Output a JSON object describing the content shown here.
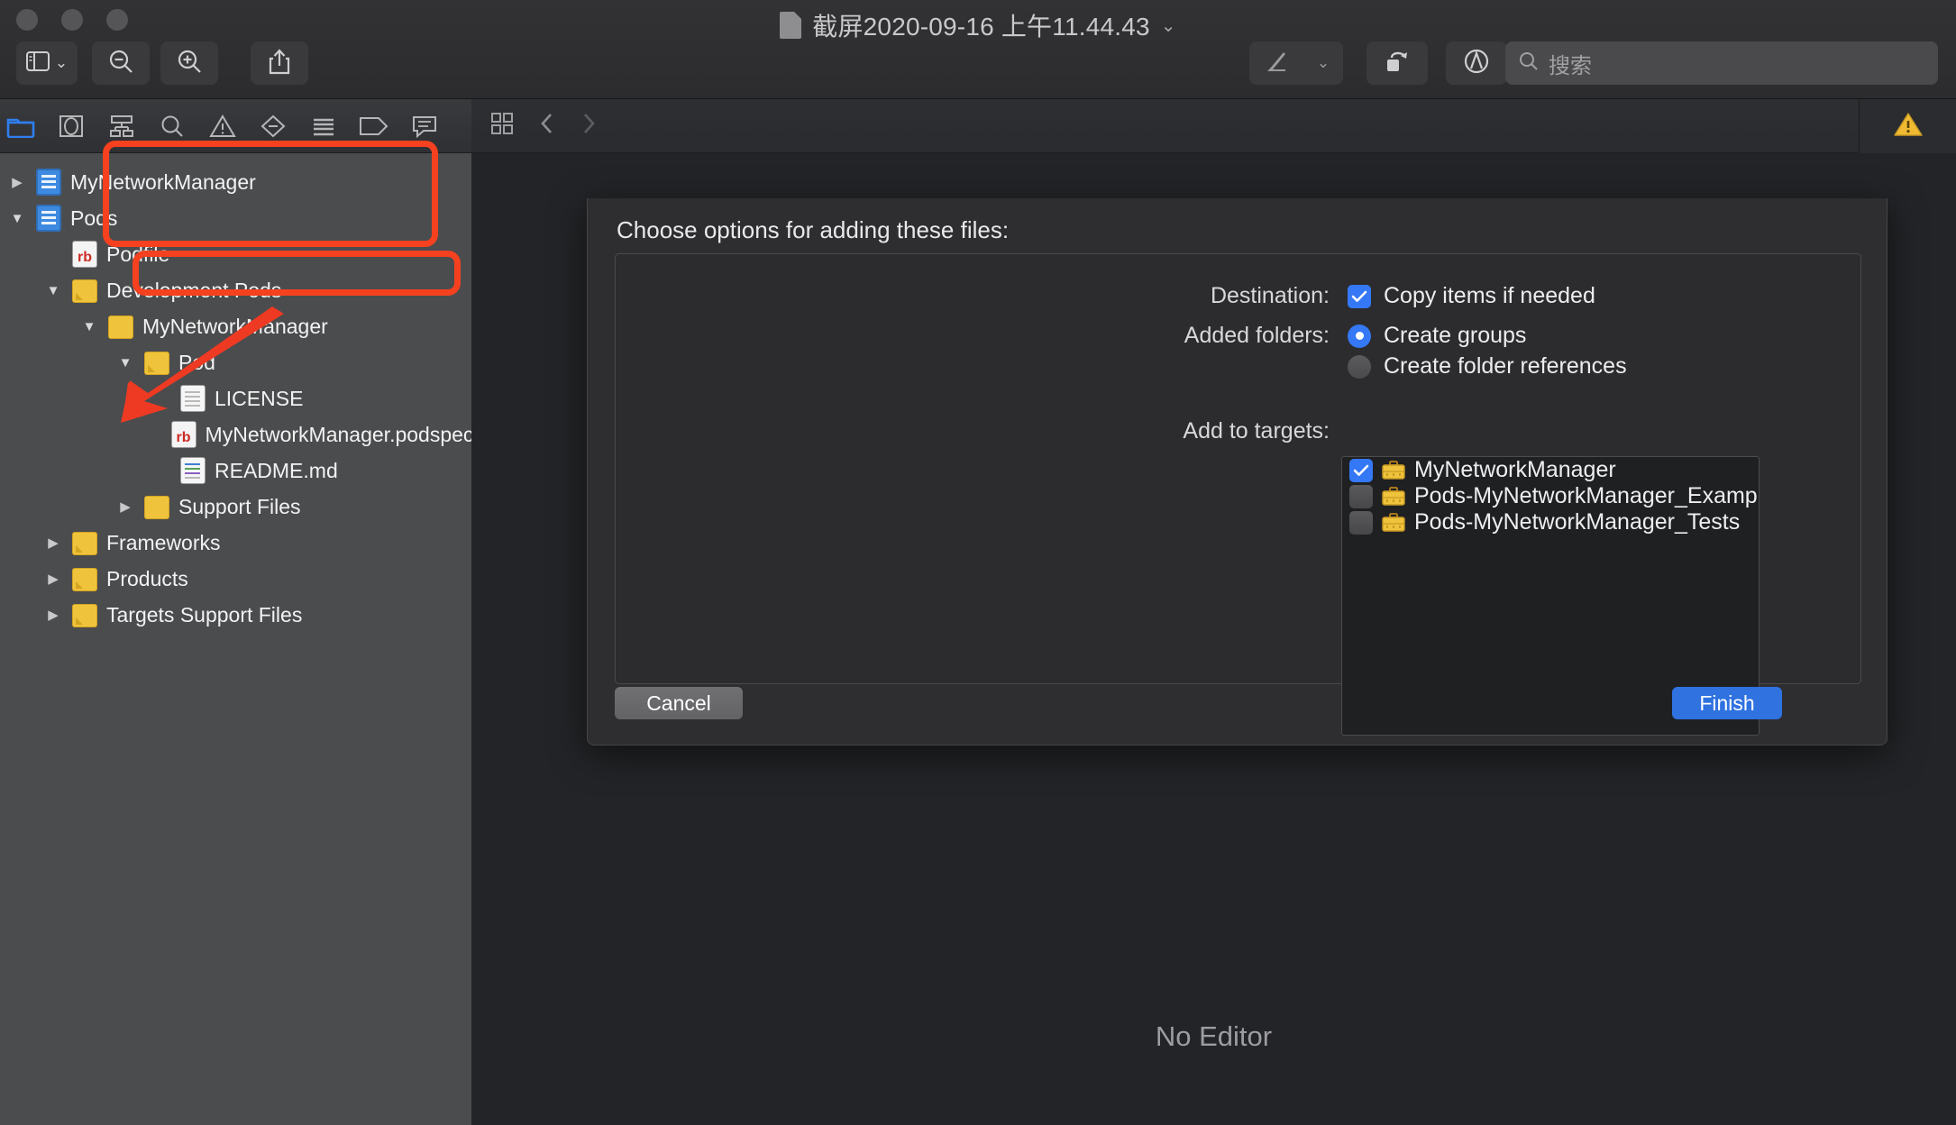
{
  "window": {
    "title": "截屏2020-09-16 上午11.44.43",
    "title_chevron": "⌄",
    "traffic_lights": [
      "close",
      "minimize",
      "zoom"
    ],
    "toolbar_left": [
      {
        "name": "sidebar-toggle",
        "icon": "sidebar-icon"
      },
      {
        "name": "zoom-out",
        "icon": "magnifier-minus-icon"
      },
      {
        "name": "zoom-in",
        "icon": "magnifier-plus-icon"
      },
      {
        "name": "share",
        "icon": "share-icon"
      }
    ],
    "toolbar_right": [
      {
        "name": "markup-tool",
        "icon": "pen-icon"
      },
      {
        "name": "rotate-tool",
        "icon": "rotate-icon"
      },
      {
        "name": "annotate-tool",
        "icon": "circle-a-icon"
      }
    ],
    "search": {
      "placeholder": "搜索",
      "value": "",
      "icon": "search-icon"
    }
  },
  "navigator": {
    "tabs": [
      {
        "name": "project-navigator",
        "icon": "folder-icon",
        "selected": true
      },
      {
        "name": "source-control-navigator",
        "icon": "version-icon",
        "selected": false
      },
      {
        "name": "symbol-navigator",
        "icon": "hierarchy-icon",
        "selected": false
      },
      {
        "name": "find-navigator",
        "icon": "search-icon",
        "selected": false
      },
      {
        "name": "issue-navigator",
        "icon": "warning-triangle-icon",
        "selected": false
      },
      {
        "name": "test-navigator",
        "icon": "diamond-minus-icon",
        "selected": false
      },
      {
        "name": "debug-navigator",
        "icon": "list-icon",
        "selected": false
      },
      {
        "name": "breakpoint-navigator",
        "icon": "tag-icon",
        "selected": false
      },
      {
        "name": "report-navigator",
        "icon": "comment-icon",
        "selected": false
      }
    ],
    "tree": [
      {
        "label": "MyNetworkManager",
        "indent": 0,
        "twisty": "collapsed",
        "icon": "project"
      },
      {
        "label": "Pods",
        "indent": 0,
        "twisty": "expanded",
        "icon": "project"
      },
      {
        "label": "Podfile",
        "indent": 1,
        "twisty": "none",
        "icon": "rb"
      },
      {
        "label": "Development Pods",
        "indent": 1,
        "twisty": "expanded",
        "icon": "folder-dogear"
      },
      {
        "label": "MyNetworkManager",
        "indent": 2,
        "twisty": "expanded",
        "icon": "folder"
      },
      {
        "label": "Pod",
        "indent": 3,
        "twisty": "expanded",
        "icon": "folder-dogear"
      },
      {
        "label": "LICENSE",
        "indent": 4,
        "twisty": "none",
        "icon": "file"
      },
      {
        "label": "MyNetworkManager.podspec",
        "indent": 4,
        "twisty": "none",
        "icon": "rb"
      },
      {
        "label": "README.md",
        "indent": 4,
        "twisty": "none",
        "icon": "md"
      },
      {
        "label": "Support Files",
        "indent": 3,
        "twisty": "collapsed",
        "icon": "folder"
      },
      {
        "label": "Frameworks",
        "indent": 1,
        "twisty": "collapsed",
        "icon": "folder-dogear"
      },
      {
        "label": "Products",
        "indent": 1,
        "twisty": "collapsed",
        "icon": "folder-dogear"
      },
      {
        "label": "Targets Support Files",
        "indent": 1,
        "twisty": "collapsed",
        "icon": "folder-dogear"
      }
    ]
  },
  "editor": {
    "jumpbar": [
      {
        "name": "related-items",
        "icon": "grid-icon"
      },
      {
        "name": "go-back",
        "icon": "chevron-left-icon"
      },
      {
        "name": "go-forward",
        "icon": "chevron-right-icon"
      }
    ],
    "placeholder": "No Editor",
    "status_icon": "warning-triangle-icon"
  },
  "sheet": {
    "title": "Choose options for adding these files:",
    "destination": {
      "label": "Destination:",
      "option": {
        "text": "Copy items if needed",
        "checked": true
      }
    },
    "added_folders": {
      "label": "Added folders:",
      "options": [
        {
          "text": "Create groups",
          "selected": true
        },
        {
          "text": "Create folder references",
          "selected": false
        }
      ]
    },
    "add_to_targets": {
      "label": "Add to targets:",
      "targets": [
        {
          "name": "MyNetworkManager",
          "checked": true,
          "icon": "target-briefcase-icon"
        },
        {
          "name": "Pods-MyNetworkManager_Example",
          "checked": false,
          "icon": "target-briefcase-icon"
        },
        {
          "name": "Pods-MyNetworkManager_Tests",
          "checked": false,
          "icon": "target-briefcase-icon"
        }
      ]
    },
    "buttons": {
      "cancel": "Cancel",
      "finish": "Finish"
    }
  },
  "annotations": {
    "color": "#f5411f",
    "boxes": [
      {
        "name": "highlight-destination-options"
      },
      {
        "name": "highlight-target-mynetworkmanager"
      }
    ],
    "arrow": {
      "name": "red-arrow-pointing-to-pod-folder"
    }
  }
}
